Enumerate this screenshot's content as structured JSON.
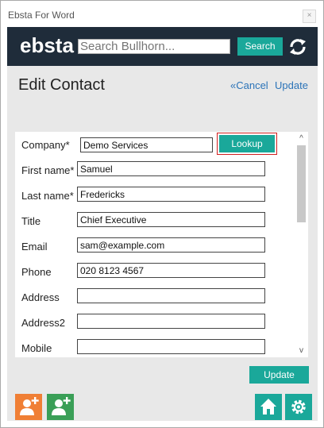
{
  "window": {
    "title": "Ebsta For Word",
    "close_glyph": "×"
  },
  "header": {
    "logo": "ebsta",
    "search_placeholder": "Search Bullhorn...",
    "search_button": "Search",
    "sync_icon": "sync-icon"
  },
  "page": {
    "title": "Edit Contact",
    "cancel_link": "«Cancel",
    "update_link": "Update"
  },
  "form": {
    "company": {
      "label": "Company*",
      "value": "Demo Services",
      "lookup_label": "Lookup"
    },
    "fields": [
      {
        "label": "First name*",
        "value": "Samuel"
      },
      {
        "label": "Last name*",
        "value": "Fredericks"
      },
      {
        "label": "Title",
        "value": "Chief Executive"
      },
      {
        "label": "Email",
        "value": "sam@example.com"
      },
      {
        "label": "Phone",
        "value": "020 8123 4567"
      },
      {
        "label": "Address",
        "value": ""
      },
      {
        "label": "Address2",
        "value": ""
      },
      {
        "label": "Mobile",
        "value": ""
      }
    ]
  },
  "scrollbar": {
    "up_glyph": "^",
    "down_glyph": "v"
  },
  "footer": {
    "update_button": "Update",
    "icons": [
      "add-contact-icon",
      "add-person-icon",
      "home-icon",
      "settings-icon"
    ]
  },
  "colors": {
    "header_bg": "#1f2c3a",
    "accent": "#1aa89a",
    "link": "#2b73b8",
    "tile_orange": "#f07f35",
    "tile_green": "#3a9f57",
    "tile_teal": "#1aa89a",
    "highlight": "#d02020"
  }
}
